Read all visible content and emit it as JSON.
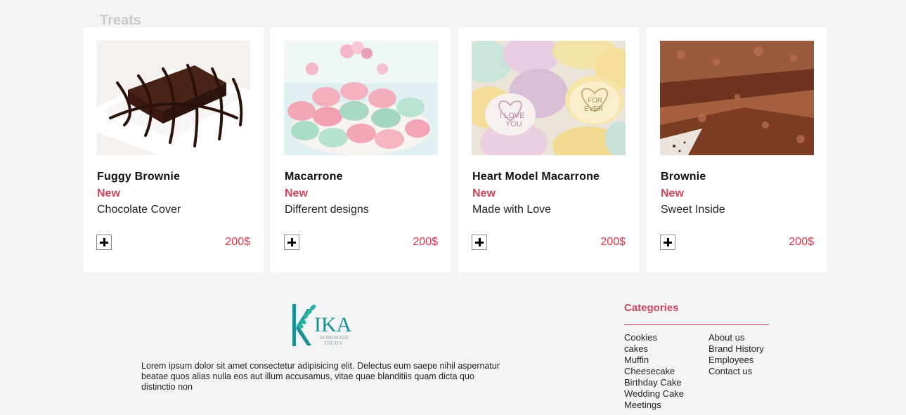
{
  "section": {
    "title": "Treats"
  },
  "carousel": {
    "prev": "‹",
    "next": "›"
  },
  "products": [
    {
      "name": "Fuggy Brownie",
      "badge": "New",
      "description": "Chocolate Cover",
      "price": "200$",
      "image": "brownie-chocolate-drizzle"
    },
    {
      "name": "Macarrone",
      "badge": "New",
      "description": "Different designs",
      "price": "200$",
      "image": "pastel-macarons"
    },
    {
      "name": "Heart Model Macarrone",
      "badge": "New",
      "description": "Made with Love",
      "price": "200$",
      "image": "heart-candies"
    },
    {
      "name": "Brownie",
      "badge": "New",
      "description": "Sweet Inside",
      "price": "200$",
      "image": "brownie-slab"
    }
  ],
  "footer": {
    "logo": {
      "text": "KIKA",
      "tagline": "HOMEMADE TREATS"
    },
    "description": "Lorem ipsum dolor sit amet consectetur adipisicing elit. Delectus eum saepe nihil aspernatur beatae quos alias nulla eos aut illum accusamus, vitae quae blanditiis quam dicta quo distinctio non",
    "categories_title": "Categories",
    "categories": [
      "Cookies",
      "cakes",
      "Muffin",
      "Cheesecake",
      "Birthday Cake",
      "Wedding Cake",
      "Meetings"
    ],
    "links": [
      "About us",
      "Brand History",
      "Employees",
      "Contact us"
    ]
  },
  "colors": {
    "accent": "#d0455b",
    "price": "#e0344b",
    "background": "#f3f4f6",
    "logo_teal": "#1a8f94"
  }
}
